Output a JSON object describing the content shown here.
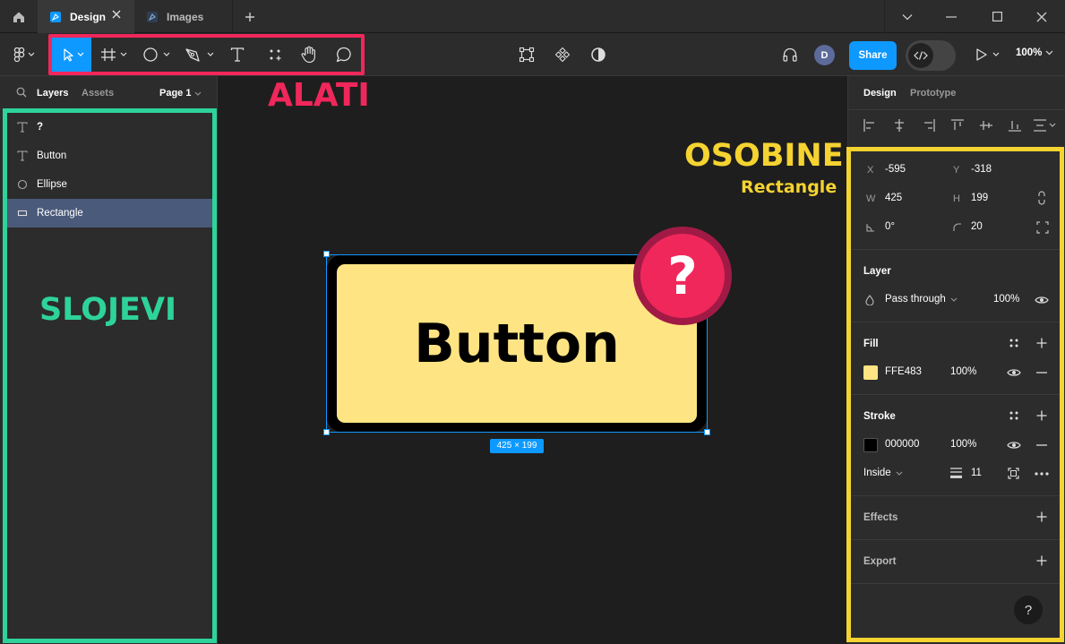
{
  "colors": {
    "accent": "#0d99ff",
    "share_button": "#0d99ff",
    "alati_annotation": "#f0275b",
    "slojevi_annotation": "#2ed39a",
    "osobine_annotation": "#f5d330",
    "button_fill": "#FFE483",
    "button_stroke": "#000000",
    "help_badge": "#f0275b",
    "help_badge_ring": "#a11a45",
    "selected_layer": "#4a5a7a"
  },
  "titlebar": {
    "tabs": [
      {
        "label": "Design",
        "icon": "figma-file-icon",
        "active": true
      },
      {
        "label": "Images",
        "icon": "figma-file-icon",
        "active": false
      }
    ],
    "icons": [
      "home-icon",
      "close-tab-icon",
      "new-tab-icon",
      "chevron-down-icon",
      "minimize-icon",
      "maximize-icon",
      "close-window-icon"
    ]
  },
  "toolbar": {
    "tools": [
      "main-menu-icon",
      "move-tool-icon",
      "frame-tool-icon",
      "ellipse-tool-icon",
      "pen-tool-icon",
      "text-tool-icon",
      "resources-icon",
      "hand-tool-icon",
      "comment-tool-icon"
    ],
    "center_tools": [
      "scale-icon",
      "component-icon",
      "contrast-icon"
    ],
    "avatar_initial": "D",
    "share_label": "Share",
    "zoom": "100%"
  },
  "annotations": {
    "tools": "ALATI",
    "layers": "SLOJEVI",
    "properties": "OSOBINE",
    "properties_sub": "Rectangle"
  },
  "left_panel": {
    "tabs": [
      "Layers",
      "Assets"
    ],
    "page": "Page 1",
    "layers": [
      {
        "name": "?",
        "icon": "text-layer-icon",
        "selected": false
      },
      {
        "name": "Button",
        "icon": "text-layer-icon",
        "selected": false
      },
      {
        "name": "Ellipse",
        "icon": "ellipse-layer-icon",
        "selected": false
      },
      {
        "name": "Rectangle",
        "icon": "rectangle-layer-icon",
        "selected": true
      }
    ]
  },
  "canvas": {
    "button_text": "Button",
    "help_mark": "?",
    "size_label": "425 × 199"
  },
  "right_panel": {
    "tabs": [
      "Design",
      "Prototype"
    ],
    "position": {
      "x_label": "X",
      "x": "-595",
      "y_label": "Y",
      "y": "-318"
    },
    "size": {
      "w_label": "W",
      "w": "425",
      "h_label": "H",
      "h": "199"
    },
    "rotation": "0°",
    "radius": "20",
    "layer": {
      "title": "Layer",
      "blend": "Pass through",
      "opacity": "100%"
    },
    "fill": {
      "title": "Fill",
      "hex": "FFE483",
      "opacity": "100%"
    },
    "stroke": {
      "title": "Stroke",
      "hex": "000000",
      "opacity": "100%",
      "position": "Inside",
      "weight": "11"
    },
    "effects": {
      "title": "Effects"
    },
    "export": {
      "title": "Export"
    },
    "help": "?"
  }
}
